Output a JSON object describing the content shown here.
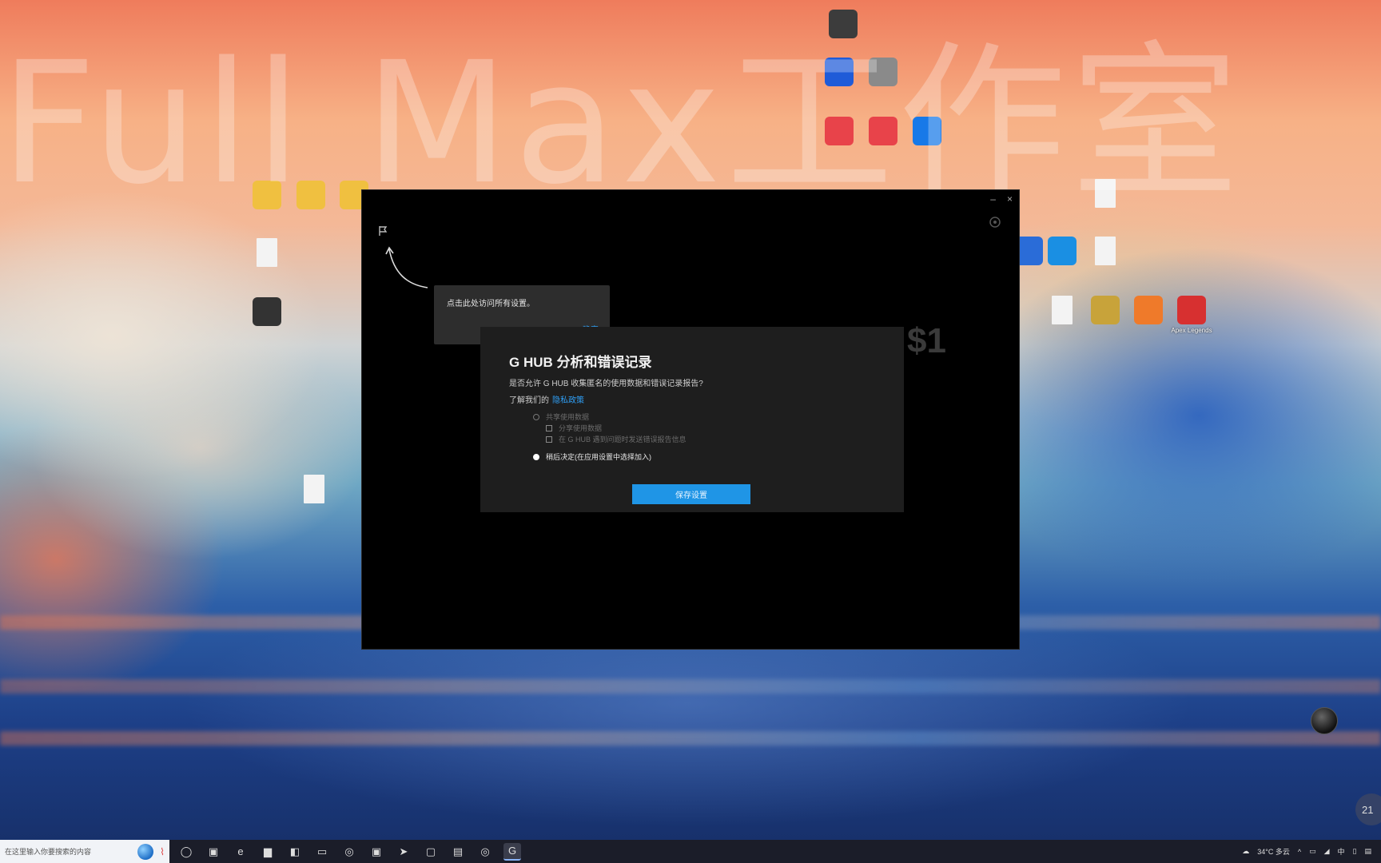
{
  "watermark": "Full Max工作室",
  "desktop": {
    "icons": [
      {
        "label": "",
        "icon": "monitor-icon",
        "color": "#3c3c3c"
      },
      {
        "label": "",
        "icon": "browser-icon",
        "color": "#1f5bd8"
      },
      {
        "label": "",
        "icon": "globe-icon",
        "color": "#8a8a8a"
      },
      {
        "label": "",
        "icon": "app-red-icon",
        "color": "#e8434a"
      },
      {
        "label": "",
        "icon": "app-red-icon",
        "color": "#e8434a"
      },
      {
        "label": "",
        "icon": "app-blue-icon",
        "color": "#1779e8"
      },
      {
        "label": "",
        "icon": "document-icon",
        "color": "#f3f3f3"
      },
      {
        "label": "",
        "icon": "shield-icon",
        "color": "#2a6cd8"
      },
      {
        "label": "",
        "icon": "app-m-icon",
        "color": "#1a8fe3"
      },
      {
        "label": "",
        "icon": "document-icon",
        "color": "#f3f3f3"
      },
      {
        "label": "",
        "icon": "document-icon",
        "color": "#f3f3f3"
      },
      {
        "label": "",
        "icon": "game-icon",
        "color": "#c8a33a"
      },
      {
        "label": "",
        "icon": "map-pin-icon",
        "color": "#ef7a2a"
      },
      {
        "label": "Apex Legends",
        "icon": "apex-icon",
        "color": "#d73030"
      },
      {
        "label": "",
        "icon": "folder-icon",
        "color": "#f0c040"
      },
      {
        "label": "",
        "icon": "folder-icon",
        "color": "#f0c040"
      },
      {
        "label": "",
        "icon": "folder-icon",
        "color": "#f0c040"
      },
      {
        "label": "",
        "icon": "document-icon",
        "color": "#f3f3f3"
      },
      {
        "label": "",
        "icon": "app-dark-icon",
        "color": "#333333"
      },
      {
        "label": "",
        "icon": "document-icon",
        "color": "#f3f3f3"
      }
    ]
  },
  "window": {
    "controls": [
      "–",
      "×"
    ],
    "tooltip": {
      "message": "点击此处访问所有设置。",
      "ok_label": "确定"
    },
    "dialog": {
      "title": "G HUB 分析和错误记录",
      "description": "是否允许 G HUB 收集匿名的使用数据和错误记录报告?",
      "learn_more_prefix": "了解我们的",
      "learn_more_link": "隐私政策",
      "options": {
        "share_label": "共享使用数据",
        "check1_label": "分享使用数据",
        "check2_label": "在 G HUB 遇到问题时发送错误报告信息",
        "later_label": "稍后决定(在应用设置中选择加入)"
      },
      "save_label": "保存设置",
      "accent": "#1f95e6"
    },
    "background_hint": "$1"
  },
  "taskbar": {
    "search_placeholder": "在这里输入你要搜索的内容",
    "apps": [
      {
        "icon": "task-view-icon",
        "glyph": "◯"
      },
      {
        "icon": "widgets-icon",
        "glyph": "▣"
      },
      {
        "icon": "edge-icon",
        "glyph": "e"
      },
      {
        "icon": "file-explorer-icon",
        "glyph": "▆"
      },
      {
        "icon": "store-icon",
        "glyph": "◧"
      },
      {
        "icon": "mail-icon",
        "glyph": "▭"
      },
      {
        "icon": "qq-icon",
        "glyph": "◎"
      },
      {
        "icon": "app-red-icon",
        "glyph": "▣"
      },
      {
        "icon": "send-icon",
        "glyph": "➤"
      },
      {
        "icon": "camera-icon",
        "glyph": "▢"
      },
      {
        "icon": "docs-icon",
        "glyph": "▤"
      },
      {
        "icon": "browser-icon",
        "glyph": "◎"
      },
      {
        "icon": "ghub-icon",
        "glyph": "G"
      }
    ],
    "tray": {
      "weather": "34°C 多云",
      "clock": "21"
    }
  }
}
